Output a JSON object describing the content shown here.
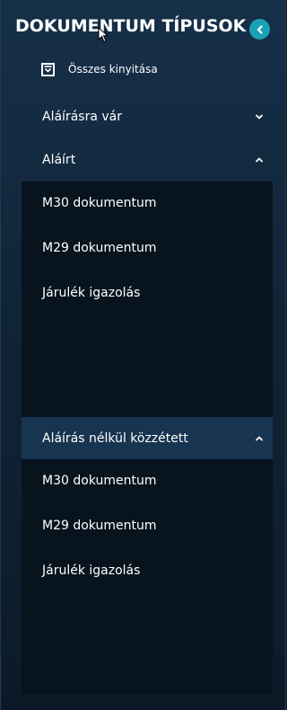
{
  "header": {
    "title": "DOKUMENTUM TÍPUSOK",
    "collapse_icon": "chevron-left-icon",
    "accent_color": "#1aa3b5"
  },
  "expand_all": {
    "label": "Összes kinyitása",
    "icon": "expand-all-icon"
  },
  "sections": [
    {
      "label": "Aláírásra vár",
      "state": "collapsed",
      "items": []
    },
    {
      "label": "Aláírt",
      "state": "expanded",
      "items": [
        "M30 dokumentum",
        "M29 dokumentum",
        "Járulék igazolás"
      ]
    },
    {
      "label": "Aláírás nélkül közzétett",
      "state": "expanded",
      "items": [
        "M30 dokumentum",
        "M29 dokumentum",
        "Járulék igazolás"
      ]
    }
  ]
}
